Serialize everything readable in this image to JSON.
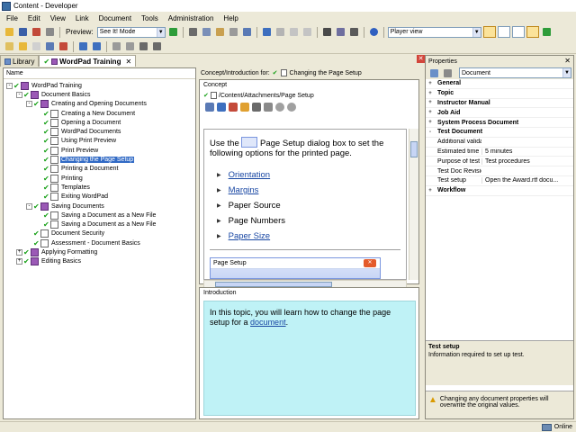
{
  "window": {
    "title": "Content - Developer"
  },
  "menu": [
    "File",
    "Edit",
    "View",
    "Link",
    "Document",
    "Tools",
    "Administration",
    "Help"
  ],
  "toolbar": {
    "preview_label": "Preview:",
    "preview_mode": "See It! Mode",
    "view_mode": "Player view"
  },
  "tabs": [
    {
      "label": "Library",
      "active": false
    },
    {
      "label": "WordPad Training",
      "active": true
    }
  ],
  "tree": {
    "header": "Name",
    "nodes": [
      {
        "label": "WordPad Training",
        "level": 0,
        "exp": "-",
        "check": true,
        "icon": "book"
      },
      {
        "label": "Document Basics",
        "level": 1,
        "exp": "-",
        "check": true,
        "icon": "book"
      },
      {
        "label": "Creating and Opening Documents",
        "level": 2,
        "exp": "-",
        "check": true,
        "icon": "book"
      },
      {
        "label": "Creating a New Document",
        "level": 3,
        "exp": "",
        "check": true,
        "icon": "page"
      },
      {
        "label": "Opening a Document",
        "level": 3,
        "exp": "",
        "check": true,
        "icon": "page"
      },
      {
        "label": "WordPad Documents",
        "level": 3,
        "exp": "",
        "check": true,
        "icon": "page"
      },
      {
        "label": "Using Print Preview",
        "level": 3,
        "exp": "",
        "check": true,
        "icon": "page"
      },
      {
        "label": "Print Preview",
        "level": 3,
        "exp": "",
        "check": true,
        "icon": "page"
      },
      {
        "label": "Changing the Page Setup",
        "level": 3,
        "exp": "",
        "check": true,
        "icon": "page",
        "selected": true
      },
      {
        "label": "Printing a Document",
        "level": 3,
        "exp": "",
        "check": true,
        "icon": "page"
      },
      {
        "label": "Printing",
        "level": 3,
        "exp": "",
        "check": true,
        "icon": "page"
      },
      {
        "label": "Templates",
        "level": 3,
        "exp": "",
        "check": true,
        "icon": "page"
      },
      {
        "label": "Exiting WordPad",
        "level": 3,
        "exp": "",
        "check": true,
        "icon": "page"
      },
      {
        "label": "Saving Documents",
        "level": 2,
        "exp": "-",
        "check": true,
        "icon": "book"
      },
      {
        "label": "Saving a Document as a New File",
        "level": 3,
        "exp": "",
        "check": true,
        "icon": "page"
      },
      {
        "label": "Saving a Document as a New File",
        "level": 3,
        "exp": "",
        "check": true,
        "icon": "page"
      },
      {
        "label": "Document Security",
        "level": 2,
        "exp": "",
        "check": true,
        "icon": "page"
      },
      {
        "label": "Assessment - Document Basics",
        "level": 2,
        "exp": "",
        "check": true,
        "icon": "page"
      },
      {
        "label": "Applying Formatting",
        "level": 1,
        "exp": "+",
        "check": true,
        "icon": "book"
      },
      {
        "label": "Editing Basics",
        "level": 1,
        "exp": "+",
        "check": true,
        "icon": "book"
      }
    ]
  },
  "concept": {
    "bar_label": "Concept/Introduction for:",
    "bar_title": "Changing the Page Setup",
    "section": "Concept",
    "path": "/Content/Attachments/Page Setup",
    "intro_text_a": "Use the",
    "intro_text_b": "Page Setup dialog box to set the following options for the printed page.",
    "options": [
      {
        "label": "Orientation",
        "link": true
      },
      {
        "label": "Margins",
        "link": true
      },
      {
        "label": "Paper Source",
        "link": false
      },
      {
        "label": "Page Numbers",
        "link": false
      },
      {
        "label": "Paper Size",
        "link": true
      }
    ],
    "dialog_title": "Page Setup"
  },
  "introduction": {
    "section": "Introduction",
    "text": "In this topic, you will learn how to change the page setup for a",
    "link": "document",
    "tail": "."
  },
  "properties": {
    "title": "Properties",
    "selector": "Document",
    "rows": [
      {
        "type": "cat",
        "exp": "+",
        "key": "General"
      },
      {
        "type": "cat",
        "exp": "+",
        "key": "Topic"
      },
      {
        "type": "cat",
        "exp": "+",
        "key": "Instructor Manual"
      },
      {
        "type": "cat",
        "exp": "+",
        "key": "Job Aid"
      },
      {
        "type": "cat",
        "exp": "+",
        "key": "System Process Document"
      },
      {
        "type": "cat",
        "exp": "-",
        "key": "Test Document"
      },
      {
        "type": "prop",
        "key": "Additional valida...",
        "value": ""
      },
      {
        "type": "prop",
        "key": "Estimated time",
        "value": "5 minutes"
      },
      {
        "type": "prop",
        "key": "Purpose of test",
        "value": "Test procedures"
      },
      {
        "type": "prop",
        "key": "Test Doc Revision",
        "value": ""
      },
      {
        "type": "prop",
        "key": "Test setup",
        "value": "Open the Award.rtf docu..."
      },
      {
        "type": "cat",
        "exp": "+",
        "key": "Workflow"
      }
    ],
    "desc_title": "Test setup",
    "desc_text": "Information required to set up test.",
    "warning": "Changing any document properties will overwrite the original values."
  },
  "status": {
    "text": "Online"
  },
  "colors": {
    "selection": "#316ac5",
    "intro_bg": "#bff2f6",
    "check": "#19a119",
    "link": "#1947a3"
  }
}
